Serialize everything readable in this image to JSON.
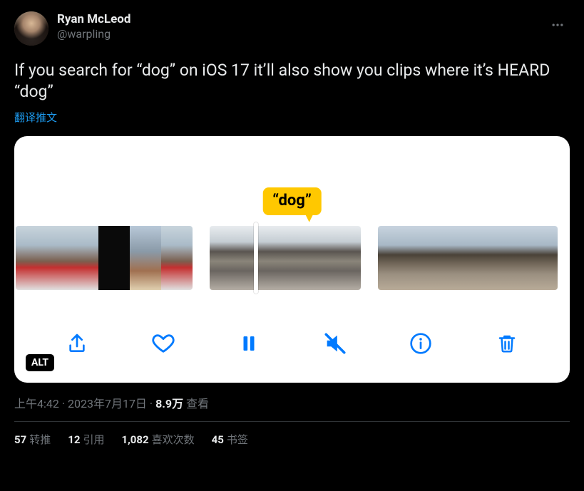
{
  "author": {
    "display_name": "Ryan McLeod",
    "handle": "@warpling"
  },
  "tweet": {
    "text": "If you search for “dog” on iOS 17 it’ll also show you clips where it’s HEARD “dog”",
    "translate_prompt": "翻译推文"
  },
  "media": {
    "search_label": "“dog”",
    "alt_badge": "ALT",
    "controls": {
      "share": "share-icon",
      "like": "heart-icon",
      "pause": "pause-icon",
      "mute": "muted-icon",
      "info": "info-icon",
      "delete": "trash-icon"
    }
  },
  "meta": {
    "time": "上午4:42",
    "dot1": " · ",
    "date": "2023年7月17日",
    "dot2": " · ",
    "views_num": "8.9万",
    "views_label": " 查看"
  },
  "stats": {
    "retweets": {
      "num": "57",
      "label": "转推"
    },
    "quotes": {
      "num": "12",
      "label": "引用"
    },
    "likes": {
      "num": "1,082",
      "label": "喜欢次数"
    },
    "bookmarks": {
      "num": "45",
      "label": "书签"
    }
  }
}
